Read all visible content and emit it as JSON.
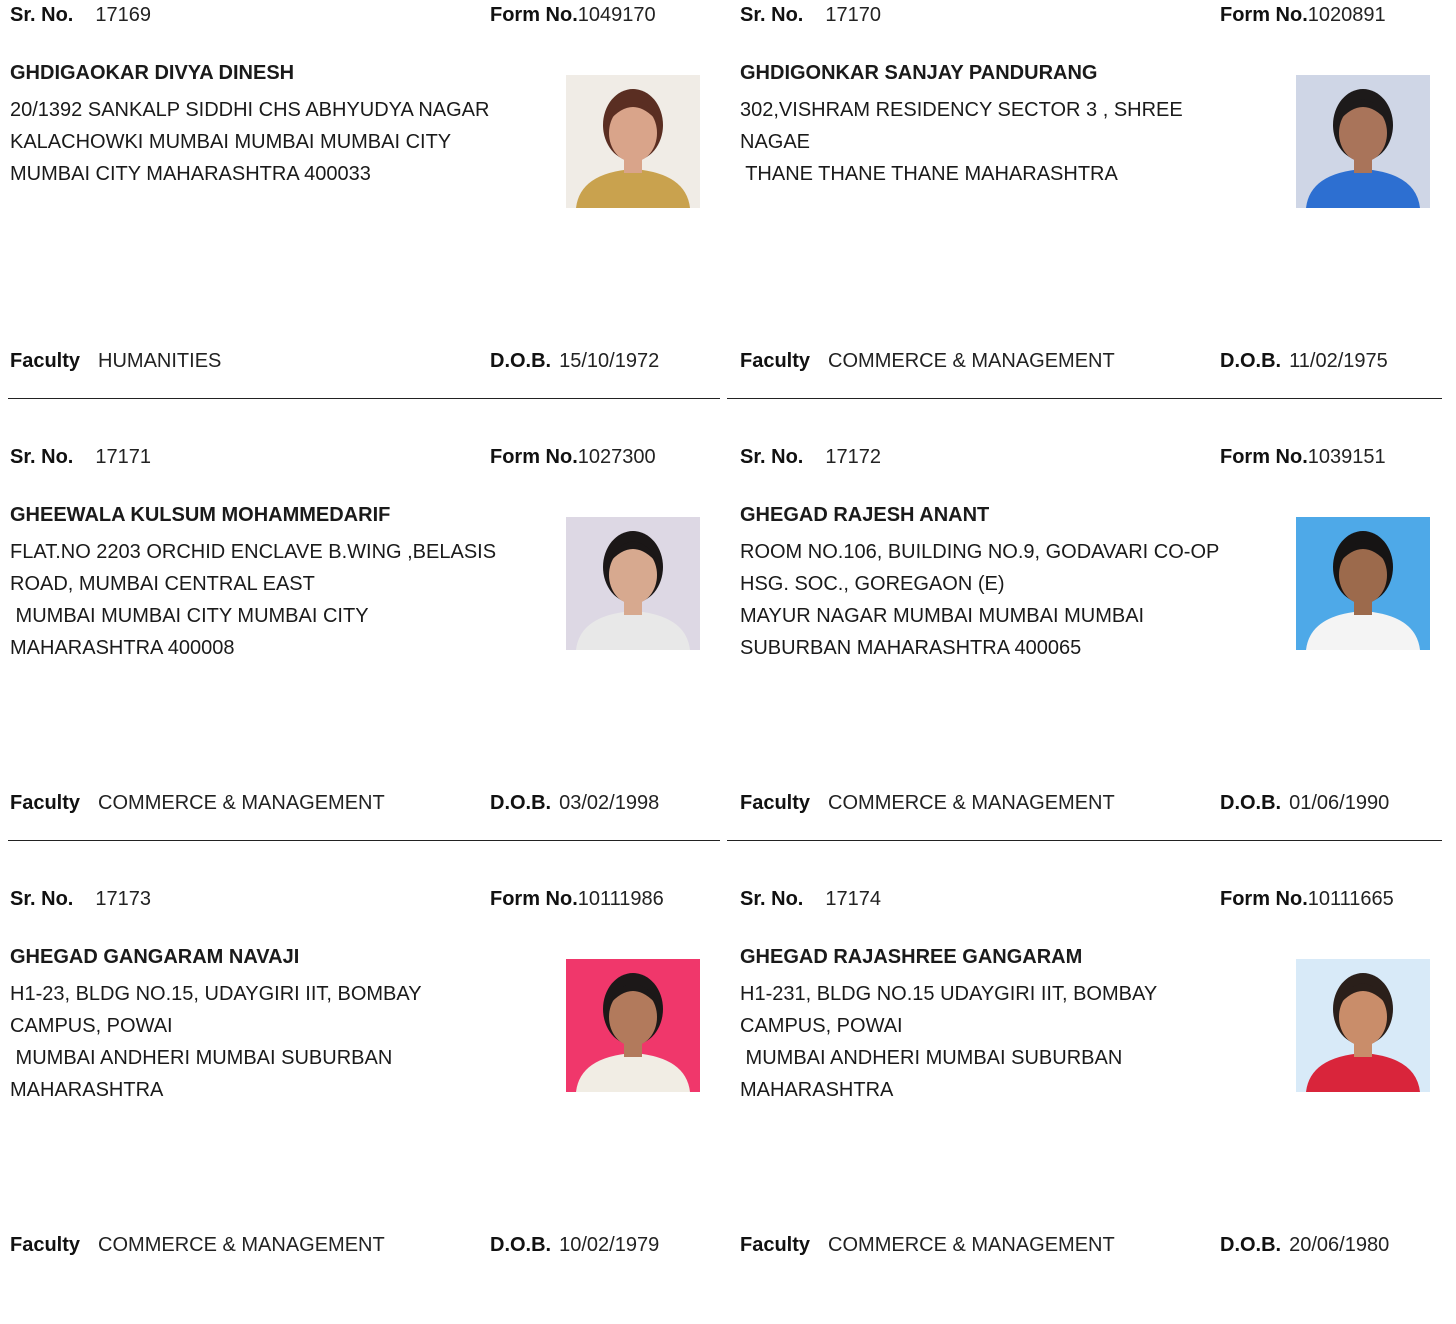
{
  "labels": {
    "sr_no": "Sr. No.",
    "form_no": "Form No.",
    "faculty": "Faculty",
    "dob": "D.O.B."
  },
  "records": [
    {
      "sr_no": "17169",
      "form_no": "1049170",
      "name": "GHDIGAOKAR DIVYA DINESH",
      "address_lines": [
        "20/1392 SANKALP SIDDHI CHS ABHYUDYA NAGAR",
        "KALACHOWKI MUMBAI MUMBAI MUMBAI CITY",
        "MUMBAI CITY MAHARASHTRA 400033"
      ],
      "faculty": "HUMANITIES",
      "dob": "15/10/1972",
      "photo": {
        "background": "#f0ece6",
        "skin": "#d9a48a",
        "hair": "#5a2e22",
        "clothing": "#c9a24e"
      }
    },
    {
      "sr_no": "17170",
      "form_no": "1020891",
      "name": "GHDIGONKAR SANJAY PANDURANG",
      "address_lines": [
        "302,VISHRAM RESIDENCY SECTOR 3 , SHREE",
        "NAGAE",
        " THANE THANE THANE MAHARASHTRA"
      ],
      "faculty": "COMMERCE & MANAGEMENT",
      "dob": "11/02/1975",
      "photo": {
        "background": "#cfd6e6",
        "skin": "#a9745a",
        "hair": "#1d1a1a",
        "clothing": "#2d6fd1"
      }
    },
    {
      "sr_no": "17171",
      "form_no": "1027300",
      "name": "GHEEWALA KULSUM MOHAMMEDARIF",
      "address_lines": [
        "FLAT.NO 2203 ORCHID ENCLAVE B.WING ,BELASIS",
        "ROAD, MUMBAI CENTRAL EAST",
        " MUMBAI MUMBAI CITY MUMBAI CITY",
        "MAHARASHTRA 400008"
      ],
      "faculty": "COMMERCE & MANAGEMENT",
      "dob": "03/02/1998",
      "photo": {
        "background": "#ddd8e4",
        "skin": "#d7a98f",
        "hair": "#1b1717",
        "clothing": "#e8e8e8"
      }
    },
    {
      "sr_no": "17172",
      "form_no": "1039151",
      "name": "GHEGAD RAJESH ANANT",
      "address_lines": [
        "ROOM NO.106, BUILDING NO.9, GODAVARI CO-OP",
        "HSG. SOC., GOREGAON (E)",
        "MAYUR NAGAR MUMBAI MUMBAI MUMBAI",
        "SUBURBAN MAHARASHTRA 400065"
      ],
      "faculty": "COMMERCE & MANAGEMENT",
      "dob": "01/06/1990",
      "photo": {
        "background": "#4ea9e8",
        "skin": "#9c6a4c",
        "hair": "#161414",
        "clothing": "#f4f4f4"
      }
    },
    {
      "sr_no": "17173",
      "form_no": "10111986",
      "name": "GHEGAD GANGARAM NAVAJI",
      "address_lines": [
        "H1-23, BLDG NO.15, UDAYGIRI IIT, BOMBAY",
        "CAMPUS, POWAI",
        " MUMBAI ANDHERI MUMBAI SUBURBAN",
        "MAHARASHTRA"
      ],
      "faculty": "COMMERCE & MANAGEMENT",
      "dob": "10/02/1979",
      "photo": {
        "background": "#f0376b",
        "skin": "#b27a5c",
        "hair": "#1c1818",
        "clothing": "#f1ede4"
      }
    },
    {
      "sr_no": "17174",
      "form_no": "10111665",
      "name": "GHEGAD RAJASHREE GANGARAM",
      "address_lines": [
        "H1-231, BLDG NO.15 UDAYGIRI IIT, BOMBAY",
        "CAMPUS, POWAI",
        " MUMBAI ANDHERI MUMBAI SUBURBAN",
        "MAHARASHTRA"
      ],
      "faculty": "COMMERCE & MANAGEMENT",
      "dob": "20/06/1980",
      "photo": {
        "background": "#d8eaf8",
        "skin": "#c98d6a",
        "hair": "#2a1f1a",
        "clothing": "#d9253b"
      }
    }
  ]
}
